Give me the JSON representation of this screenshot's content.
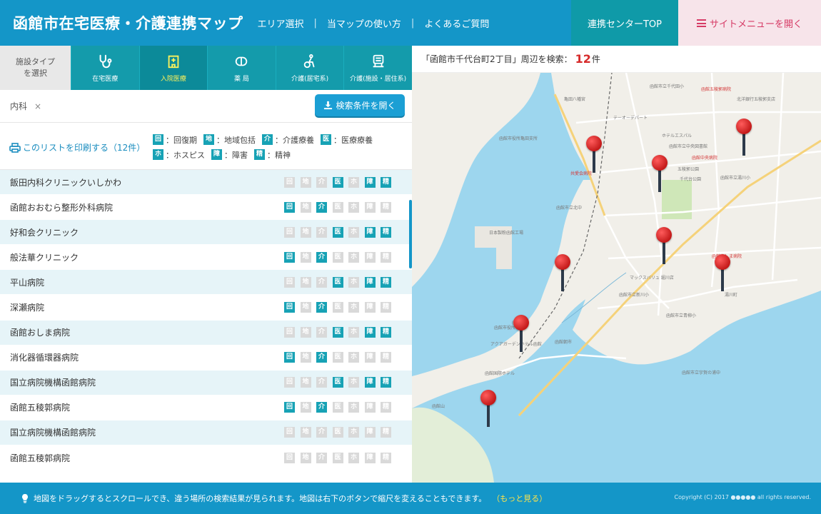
{
  "header": {
    "site_title": "函館市在宅医療・介護連携マップ",
    "nav": [
      {
        "label": "エリア選択"
      },
      {
        "label": "当マップの使い方"
      },
      {
        "label": "よくあるご質問"
      }
    ],
    "separator": "|",
    "center_top_label": "連携センターTOP",
    "site_menu_label": "サイトメニューを開く",
    "colors": {
      "header_bg": "#1496c8",
      "center_top_bg": "#0f9aa8",
      "menu_bg": "#f7e4ea",
      "menu_text": "#d63a65"
    }
  },
  "facility_types": {
    "label": "施設タイプ\nを選択",
    "tabs": [
      {
        "label": "在宅医療",
        "icon": "stethoscope-icon",
        "active": false
      },
      {
        "label": "入院医療",
        "icon": "hospital-icon",
        "active": true
      },
      {
        "label": "薬 局",
        "icon": "pill-icon",
        "active": false
      },
      {
        "label": "介護(居宅系)",
        "icon": "caregiver-icon",
        "active": false
      },
      {
        "label": "介護(施設・居住系)",
        "icon": "facility-icon",
        "active": false
      }
    ]
  },
  "filter": {
    "chip_label": "内科",
    "chip_close": "×",
    "open_button_label": "検索条件を開く"
  },
  "legend": {
    "print_label": "このリストを印刷する（12件）",
    "line1": [
      {
        "badge": "回",
        "text": "：回復期"
      },
      {
        "badge": "地",
        "text": "：地域包括"
      },
      {
        "badge": "介",
        "text": "：介護療養"
      },
      {
        "badge": "医",
        "text": "：医療療養"
      }
    ],
    "line2": [
      {
        "badge": "ホ",
        "text": "：ホスピス"
      },
      {
        "badge": "障",
        "text": "：障害"
      },
      {
        "badge": "精",
        "text": "：精神"
      }
    ]
  },
  "facilities": [
    {
      "name": "飯田内科クリニックいしかわ",
      "flags": [
        false,
        false,
        false,
        true,
        false,
        true,
        true
      ]
    },
    {
      "name": "函館おおむら整形外科病院",
      "flags": [
        true,
        false,
        true,
        false,
        false,
        false,
        false
      ]
    },
    {
      "name": "好和会クリニック",
      "flags": [
        false,
        false,
        false,
        true,
        false,
        true,
        true
      ]
    },
    {
      "name": "般法華クリニック",
      "flags": [
        true,
        false,
        true,
        false,
        false,
        false,
        false
      ]
    },
    {
      "name": "平山病院",
      "flags": [
        false,
        false,
        false,
        true,
        false,
        true,
        true
      ]
    },
    {
      "name": "深瀬病院",
      "flags": [
        true,
        false,
        true,
        false,
        false,
        false,
        false
      ]
    },
    {
      "name": "函館おしま病院",
      "flags": [
        false,
        false,
        false,
        true,
        false,
        true,
        true
      ]
    },
    {
      "name": "消化器循環器病院",
      "flags": [
        true,
        false,
        true,
        false,
        false,
        false,
        false
      ]
    },
    {
      "name": "国立病院機構函館病院",
      "flags": [
        false,
        false,
        false,
        true,
        false,
        true,
        true
      ]
    },
    {
      "name": "函館五稜郭病院",
      "flags": [
        true,
        false,
        true,
        false,
        false,
        false,
        false
      ]
    },
    {
      "name": "国立病院機構函館病院",
      "flags": [
        false,
        false,
        false,
        false,
        false,
        false,
        false
      ]
    },
    {
      "name": "函館五稜郭病院",
      "flags": [
        false,
        false,
        false,
        false,
        false,
        false,
        false
      ]
    }
  ],
  "badge_labels": [
    "回",
    "地",
    "介",
    "医",
    "ホ",
    "障",
    "精"
  ],
  "map": {
    "search_prefix": "「函館市千代台町2丁目」周辺を検索：",
    "count": "12",
    "count_suffix": "件",
    "pins": 8,
    "labels": [
      "函館市立千代田小",
      "函館五稜郭病院",
      "北洋銀行五稜郭支店",
      "亀田八幡宮",
      "テーオーデパート",
      "函館市役所亀田支所",
      "ホテルエスパル",
      "函館市立中央図書館",
      "函館中央病院",
      "五稜郭公園",
      "函館市立湯川小",
      "共愛会病院",
      "千代台公園",
      "函館市立北中",
      "日本製粉函館工場",
      "函館おしま病院",
      "マックスバリュ 堀川店",
      "函館市立新川小",
      "函館市役所",
      "アクアガーデンホテル函館",
      "函館国際ホテル",
      "函館駅",
      "函館市立青柳小",
      "函館朝市",
      "函館山",
      "湯川町",
      "函館市立宇賀の浦中"
    ]
  },
  "footer": {
    "text": "地図をドラッグするとスクロールでき、違う場所の検索結果が見られます。地図は右下のボタンで縮尺を変えることもできます。",
    "more_label": "（もっと見る）",
    "copyright": "Copyright (C) 2017 ●●●●● all rights reserved."
  }
}
